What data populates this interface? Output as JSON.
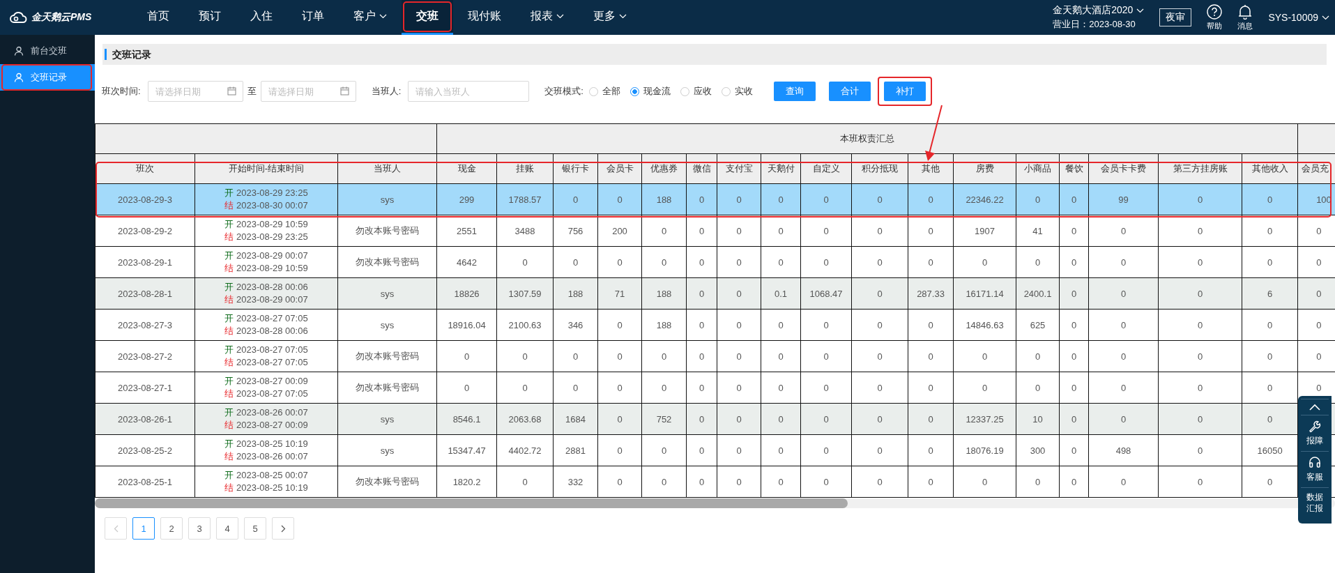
{
  "topbar": {
    "brand": "金天鹅云PMS",
    "nav": [
      {
        "label": "首页",
        "selected": false,
        "dropdown": false,
        "annotated": false
      },
      {
        "label": "预订",
        "selected": false,
        "dropdown": false,
        "annotated": false
      },
      {
        "label": "入住",
        "selected": false,
        "dropdown": false,
        "annotated": false
      },
      {
        "label": "订单",
        "selected": false,
        "dropdown": false,
        "annotated": false
      },
      {
        "label": "客户",
        "selected": false,
        "dropdown": true,
        "annotated": false
      },
      {
        "label": "交班",
        "selected": true,
        "dropdown": false,
        "annotated": true
      },
      {
        "label": "现付账",
        "selected": false,
        "dropdown": false,
        "annotated": false
      },
      {
        "label": "报表",
        "selected": false,
        "dropdown": true,
        "annotated": false
      },
      {
        "label": "更多",
        "selected": false,
        "dropdown": true,
        "annotated": false
      }
    ],
    "hotel": "金天鹅大酒店2020",
    "business_day": "营业日：2023-08-30",
    "night_audit": "夜审",
    "help": "帮助",
    "messages": "消息",
    "user": "SYS-10009"
  },
  "sidebar": {
    "items": [
      {
        "label": "前台交班",
        "selected": false,
        "annotated": false
      },
      {
        "label": "交班记录",
        "selected": true,
        "annotated": true
      }
    ]
  },
  "section_title": "交班记录",
  "filters": {
    "time_label": "班次时间:",
    "date_from": {
      "placeholder": "请选择日期"
    },
    "to": "至",
    "date_to": {
      "placeholder": "请选择日期"
    },
    "person_label": "当班人:",
    "person": {
      "placeholder": "请输入当班人"
    },
    "mode_label": "交班模式:",
    "modes": [
      {
        "label": "全部",
        "selected": false
      },
      {
        "label": "现金流",
        "selected": true
      },
      {
        "label": "应收",
        "selected": false
      },
      {
        "label": "实收",
        "selected": false
      }
    ],
    "buttons": [
      {
        "label": "查询",
        "annotated": false
      },
      {
        "label": "合计",
        "annotated": false
      },
      {
        "label": "补打",
        "annotated": true
      }
    ]
  },
  "table": {
    "group": "本班权责汇总",
    "highlight_frame": true,
    "columns": [
      "班次",
      "开始时间-结束时间",
      "当班人",
      "现金",
      "挂账",
      "银行卡",
      "会员卡",
      "优惠券",
      "微信",
      "支付宝",
      "天鹅付",
      "自定义",
      "积分抵现",
      "其他",
      "房费",
      "小商品",
      "餐饮",
      "会员卡卡费",
      "第三方挂房账",
      "其他收入",
      "会员充"
    ],
    "rows": [
      {
        "shift": "2023-08-29-3",
        "start_label": "开",
        "start": "2023-08-29 23:25",
        "end_label": "结",
        "end": "2023-08-30 00:07",
        "person": "sys",
        "values": [
          "299",
          "1788.57",
          "0",
          "0",
          "188",
          "0",
          "0",
          "0",
          "0",
          "0",
          "0",
          "22346.22",
          "0",
          "0",
          "99",
          "0",
          "0",
          "100"
        ],
        "selected": true,
        "shaded": false
      },
      {
        "shift": "2023-08-29-2",
        "start_label": "开",
        "start": "2023-08-29 10:59",
        "end_label": "结",
        "end": "2023-08-29 23:25",
        "person": "勿改本账号密码",
        "values": [
          "2551",
          "3488",
          "756",
          "200",
          "0",
          "0",
          "0",
          "0",
          "0",
          "0",
          "0",
          "1907",
          "41",
          "0",
          "0",
          "0",
          "0",
          "0"
        ],
        "selected": false,
        "shaded": false
      },
      {
        "shift": "2023-08-29-1",
        "start_label": "开",
        "start": "2023-08-29 00:07",
        "end_label": "结",
        "end": "2023-08-29 10:59",
        "person": "勿改本账号密码",
        "values": [
          "4642",
          "0",
          "0",
          "0",
          "0",
          "0",
          "0",
          "0",
          "0",
          "0",
          "0",
          "0",
          "0",
          "0",
          "0",
          "0",
          "0",
          "0"
        ],
        "selected": false,
        "shaded": false
      },
      {
        "shift": "2023-08-28-1",
        "start_label": "开",
        "start": "2023-08-28 00:06",
        "end_label": "结",
        "end": "2023-08-29 00:07",
        "person": "sys",
        "values": [
          "18826",
          "1307.59",
          "188",
          "71",
          "188",
          "0",
          "0",
          "0.1",
          "1068.47",
          "0",
          "287.33",
          "16171.14",
          "2400.1",
          "0",
          "0",
          "0",
          "6",
          "0"
        ],
        "selected": false,
        "shaded": true
      },
      {
        "shift": "2023-08-27-3",
        "start_label": "开",
        "start": "2023-08-27 07:05",
        "end_label": "结",
        "end": "2023-08-28 00:06",
        "person": "sys",
        "values": [
          "18916.04",
          "2100.63",
          "346",
          "0",
          "188",
          "0",
          "0",
          "0",
          "0",
          "0",
          "0",
          "14846.63",
          "625",
          "0",
          "0",
          "0",
          "0",
          "0"
        ],
        "selected": false,
        "shaded": false
      },
      {
        "shift": "2023-08-27-2",
        "start_label": "开",
        "start": "2023-08-27 07:05",
        "end_label": "结",
        "end": "2023-08-27 07:05",
        "person": "勿改本账号密码",
        "values": [
          "0",
          "0",
          "0",
          "0",
          "0",
          "0",
          "0",
          "0",
          "0",
          "0",
          "0",
          "0",
          "0",
          "0",
          "0",
          "0",
          "0",
          "0"
        ],
        "selected": false,
        "shaded": false
      },
      {
        "shift": "2023-08-27-1",
        "start_label": "开",
        "start": "2023-08-27 00:09",
        "end_label": "结",
        "end": "2023-08-27 07:05",
        "person": "勿改本账号密码",
        "values": [
          "0",
          "0",
          "0",
          "0",
          "0",
          "0",
          "0",
          "0",
          "0",
          "0",
          "0",
          "0",
          "0",
          "0",
          "0",
          "0",
          "0",
          "0"
        ],
        "selected": false,
        "shaded": false
      },
      {
        "shift": "2023-08-26-1",
        "start_label": "开",
        "start": "2023-08-26 00:07",
        "end_label": "结",
        "end": "2023-08-27 00:09",
        "person": "sys",
        "values": [
          "8546.1",
          "2063.68",
          "1684",
          "0",
          "752",
          "0",
          "0",
          "0",
          "0",
          "0",
          "0",
          "12337.25",
          "10",
          "0",
          "0",
          "0",
          "0"
        ],
        "selected": false,
        "shaded": true
      },
      {
        "shift": "2023-08-25-2",
        "start_label": "开",
        "start": "2023-08-25 10:19",
        "end_label": "结",
        "end": "2023-08-26 00:07",
        "person": "sys",
        "values": [
          "15347.47",
          "4402.72",
          "2881",
          "0",
          "0",
          "0",
          "0",
          "0",
          "0",
          "0",
          "0",
          "18076.19",
          "300",
          "0",
          "498",
          "0",
          "16050"
        ],
        "selected": false,
        "shaded": false
      },
      {
        "shift": "2023-08-25-1",
        "start_label": "开",
        "start": "2023-08-25 00:07",
        "end_label": "结",
        "end": "2023-08-25 10:19",
        "person": "勿改本账号密码",
        "values": [
          "1820.2",
          "0",
          "332",
          "0",
          "0",
          "0",
          "0",
          "0",
          "0",
          "0",
          "0",
          "0",
          "0",
          "0",
          "0",
          "0",
          "0"
        ],
        "selected": false,
        "shaded": false
      }
    ]
  },
  "pagination": {
    "pages": [
      {
        "label": "1",
        "selected": true
      },
      {
        "label": "2",
        "selected": false
      },
      {
        "label": "3",
        "selected": false
      },
      {
        "label": "4",
        "selected": false
      },
      {
        "label": "5",
        "selected": false
      }
    ],
    "prev_disabled": true
  },
  "float_bar": {
    "items": [
      {
        "kind": "top"
      },
      {
        "kind": "wrench",
        "label": "报障"
      },
      {
        "kind": "headset",
        "label": "客服"
      },
      {
        "kind": "text",
        "label": "数据汇报"
      }
    ]
  }
}
